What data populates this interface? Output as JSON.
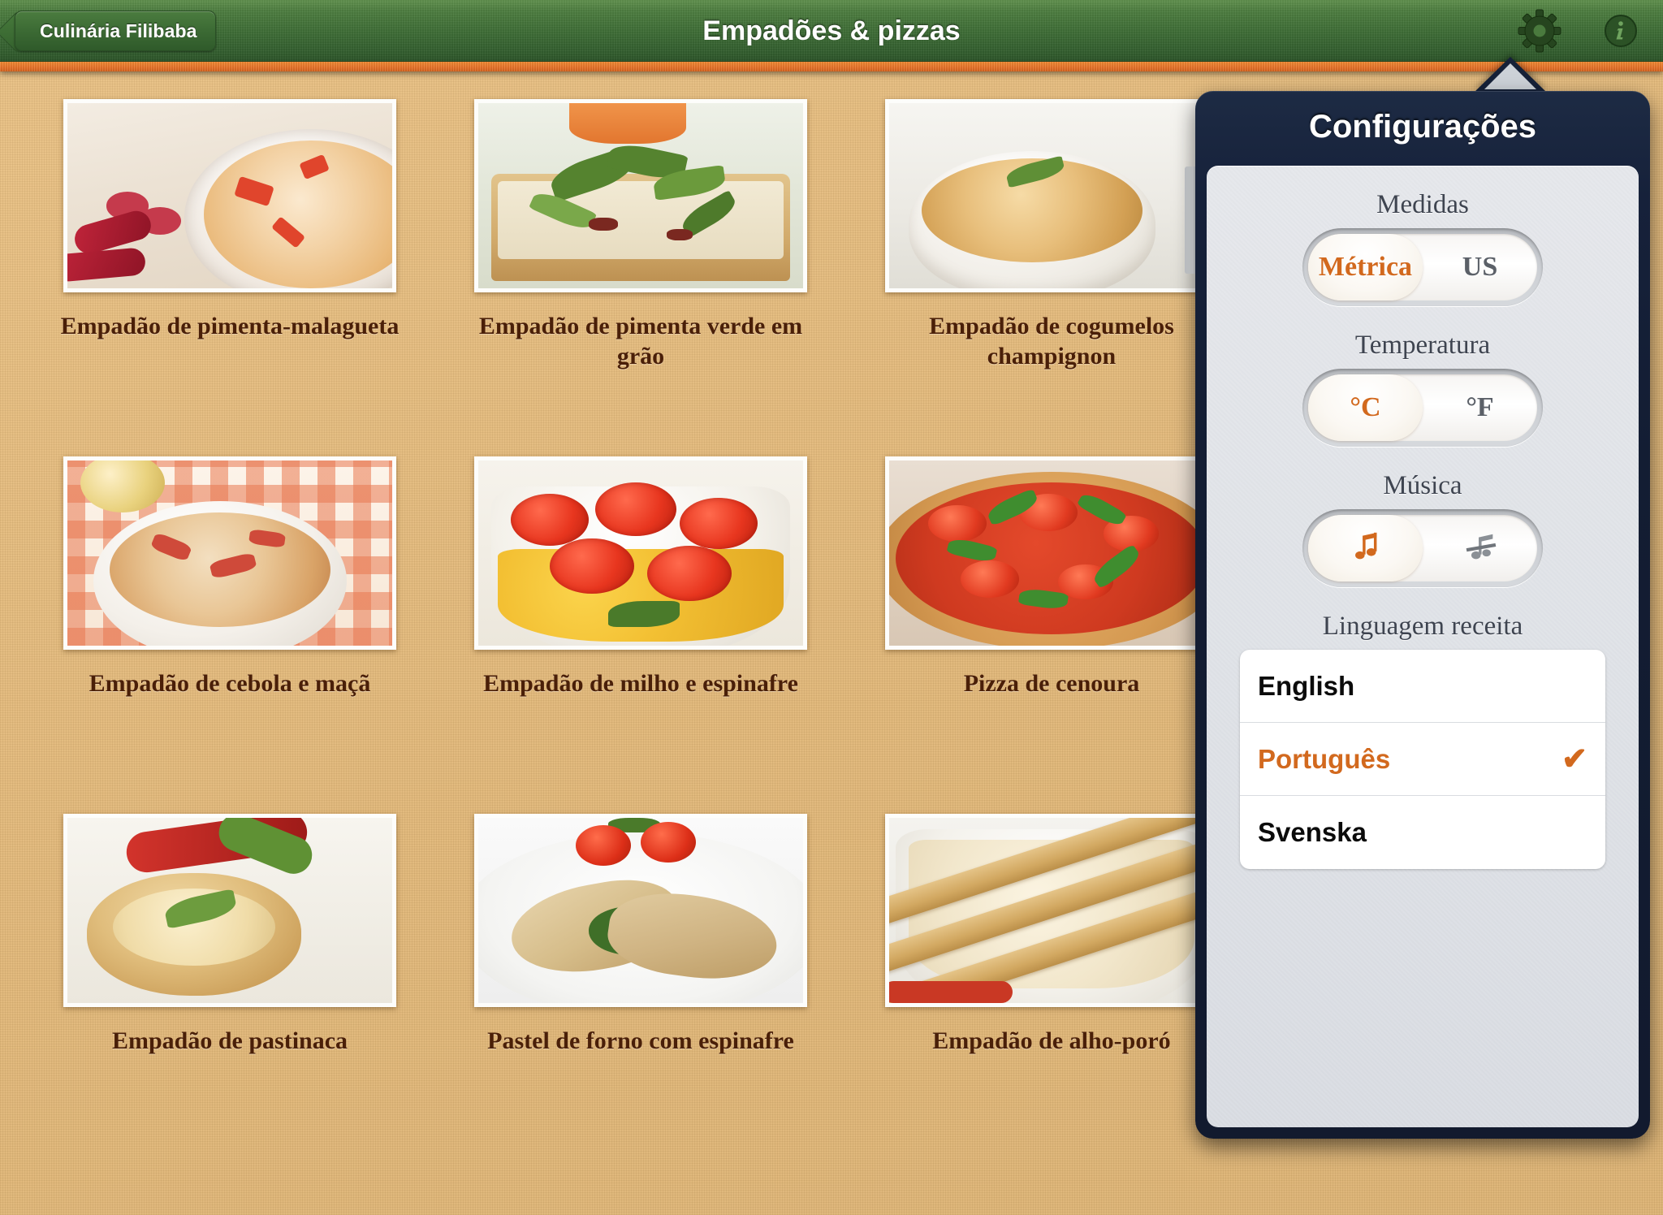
{
  "navbar": {
    "back_label": "Culinária Filibaba",
    "title": "Empadões & pizzas",
    "gear_icon": "gear-icon",
    "info_icon": "info-icon"
  },
  "recipes": [
    {
      "caption": "Empadão de pimenta-malagueta"
    },
    {
      "caption": "Empadão de pimenta verde em grão"
    },
    {
      "caption": "Empadão de cogumelos champignon"
    },
    {
      "caption": "Empadão de cebola e maçã"
    },
    {
      "caption": "Empadão de milho e espinafre"
    },
    {
      "caption": "Pizza de cenoura"
    },
    {
      "caption": "Empadão de pastinaca"
    },
    {
      "caption": "Pastel de forno com espinafre"
    },
    {
      "caption": "Empadão de alho-poró"
    }
  ],
  "settings": {
    "title": "Configurações",
    "measures": {
      "label": "Medidas",
      "options": [
        "Métrica",
        "US"
      ],
      "selected": "Métrica"
    },
    "temperature": {
      "label": "Temperatura",
      "options": [
        "°C",
        "°F"
      ],
      "selected": "°C"
    },
    "music": {
      "label": "Música",
      "options": [
        "music-on-icon",
        "music-off-icon"
      ],
      "selected": "music-on-icon"
    },
    "language": {
      "label": "Linguagem receita",
      "options": [
        "English",
        "Português",
        "Svenska"
      ],
      "selected": "Português",
      "check_glyph": "✔"
    }
  },
  "colors": {
    "accent_orange": "#d2691e",
    "nav_green": "#3f6e37",
    "stripe_orange": "#e8742a",
    "background_tan": "#e0b677",
    "caption_brown": "#4a1f08",
    "popover_navy": "#16213a"
  }
}
